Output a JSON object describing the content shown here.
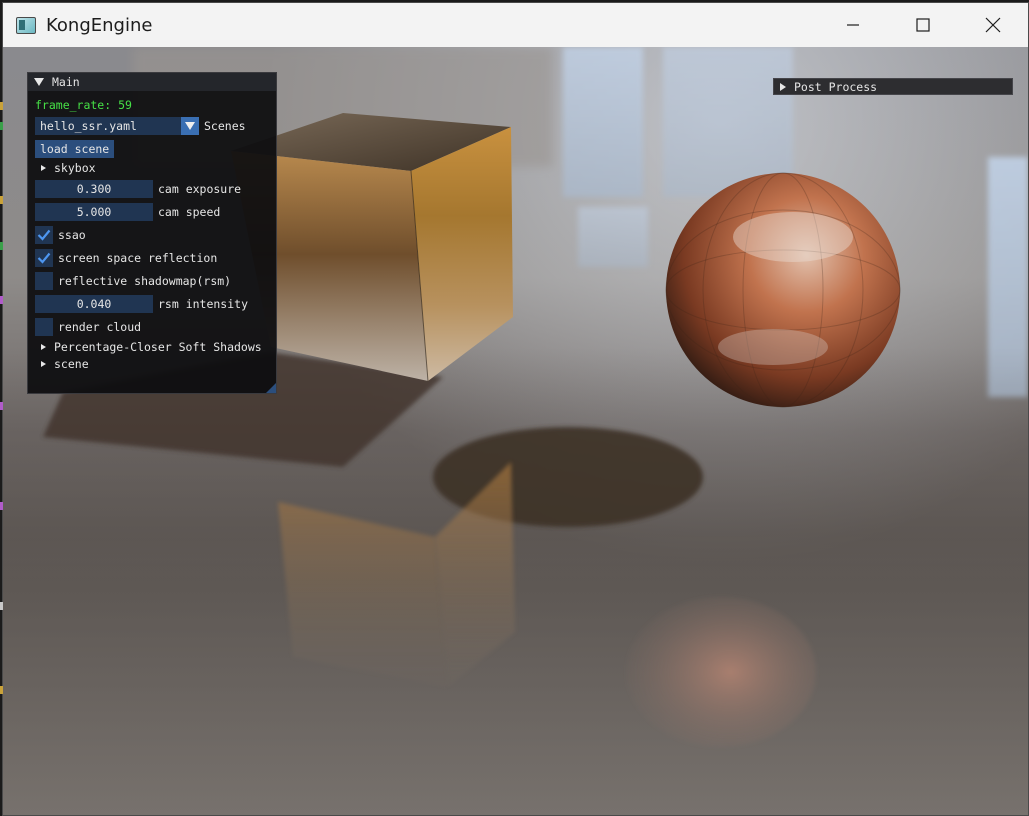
{
  "window": {
    "title": "KongEngine",
    "icon": "app-window-icon",
    "controls": [
      "minimize-icon",
      "maximize-icon",
      "close-icon"
    ]
  },
  "main_panel": {
    "title": "Main",
    "frame_rate_label": "frame_rate: 59",
    "scene_combo": {
      "value": "hello_ssr.yaml",
      "label": "Scenes"
    },
    "load_scene_button": "load scene",
    "skybox_node": "skybox",
    "cam_exposure": {
      "value": "0.300",
      "label": "cam exposure"
    },
    "cam_speed": {
      "value": "5.000",
      "label": "cam speed"
    },
    "ssao": {
      "label": "ssao",
      "checked": true
    },
    "ssr": {
      "label": "screen space reflection",
      "checked": true
    },
    "rsm": {
      "label": "reflective shadowmap(rsm)",
      "checked": false
    },
    "rsm_intensity": {
      "value": "0.040",
      "label": "rsm intensity"
    },
    "render_cloud": {
      "label": "render cloud",
      "checked": false
    },
    "pcss_node": "Percentage-Closer Soft Shadows",
    "scene_node": "scene"
  },
  "post_process_panel": {
    "title": "Post Process"
  },
  "colors": {
    "accent": "#3a6fb3",
    "frame_bg": "#203552",
    "button": "#2b4e7d",
    "fps_text": "#46e046",
    "panel_bg": "#0e0e10"
  }
}
